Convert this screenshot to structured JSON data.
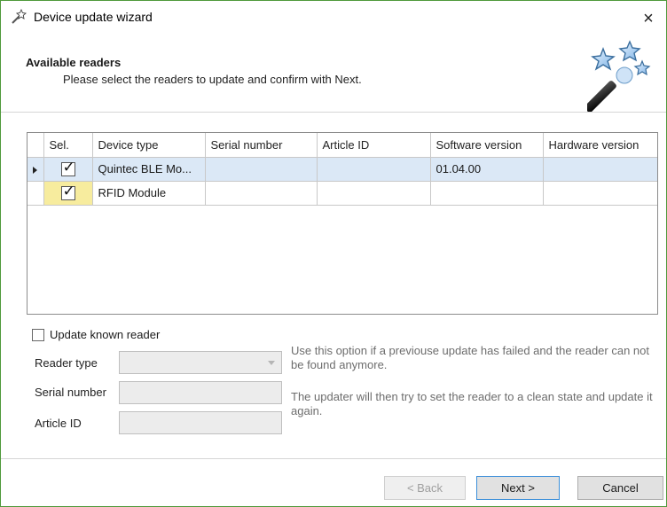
{
  "window": {
    "title": "Device update wizard",
    "close_glyph": "×"
  },
  "header": {
    "title": "Available readers",
    "subtitle": "Please select the readers to update and confirm with Next.",
    "icon": "magic-wand-stars-icon"
  },
  "grid": {
    "columns": [
      "Sel.",
      "Device type",
      "Serial number",
      "Article ID",
      "Software version",
      "Hardware version"
    ],
    "rows": [
      {
        "selected": true,
        "current": true,
        "device_type": "Quintec BLE Mo...",
        "serial_number": "",
        "article_id": "",
        "software_version": "01.04.00",
        "hardware_version": ""
      },
      {
        "selected": true,
        "current": false,
        "device_type": "RFID Module",
        "serial_number": "",
        "article_id": "",
        "software_version": "",
        "hardware_version": ""
      }
    ]
  },
  "known_reader": {
    "checkbox_label": "Update known reader",
    "checked": false,
    "reader_type_label": "Reader type",
    "reader_type_value": "",
    "serial_number_label": "Serial number",
    "serial_number_value": "",
    "article_id_label": "Article ID",
    "article_id_value": "",
    "hint_1": "Use this option if a previouse update has failed and the reader can not be found anymore.",
    "hint_2": "The updater will then try to set the reader to a clean state and update it again."
  },
  "buttons": {
    "back": "< Back",
    "next": "Next >",
    "cancel": "Cancel"
  },
  "colors": {
    "selected_row": "#dbe8f6",
    "sel_cell_highlight": "#f7ec9e",
    "next_border": "#3c8fd9"
  }
}
